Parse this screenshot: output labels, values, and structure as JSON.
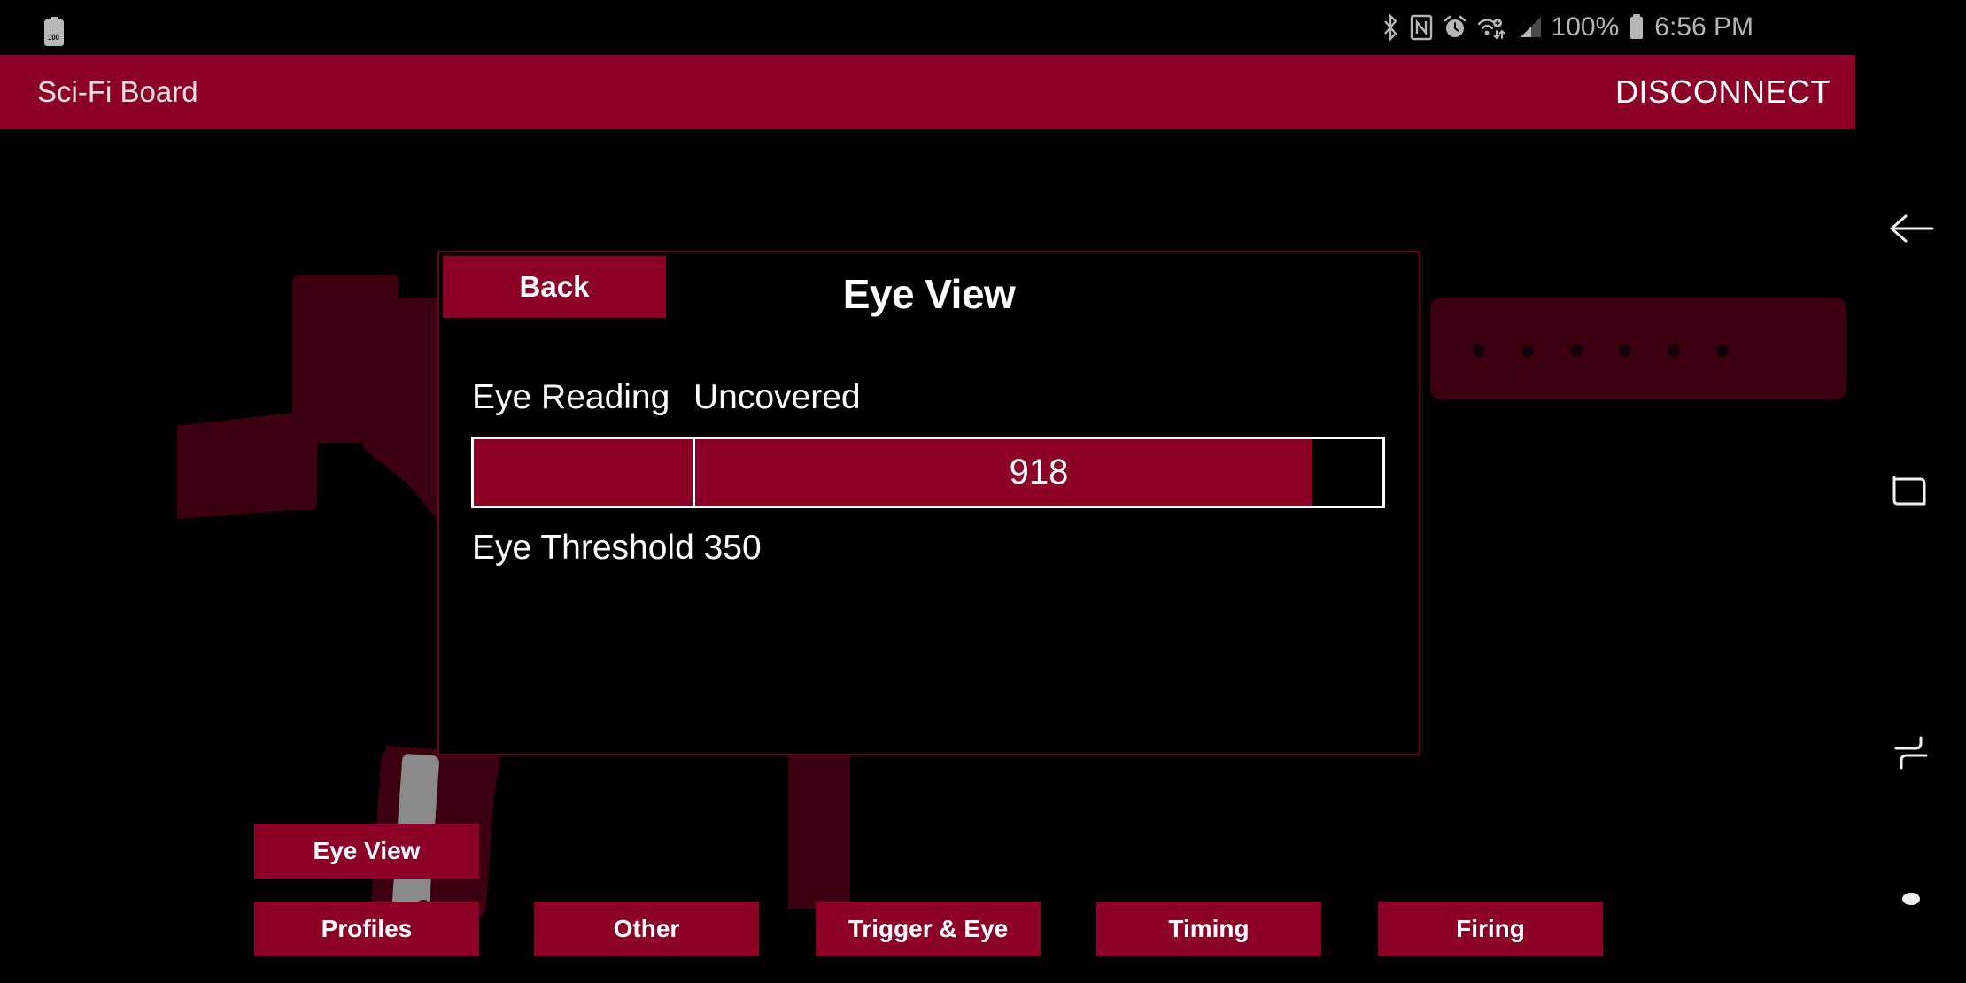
{
  "status_bar": {
    "battery_badge": "100",
    "icons": [
      "bluetooth-icon",
      "nfc-icon",
      "alarm-icon",
      "wifi-transfer-icon",
      "cellular-signal-icon"
    ],
    "battery_percent": "100%",
    "battery_icon": "battery-full-icon",
    "clock": "6:56 PM"
  },
  "app_bar": {
    "title": "Sci-Fi Board",
    "action_label": "DISCONNECT",
    "background_color": "#8c0028"
  },
  "dialog": {
    "back_label": "Back",
    "title": "Eye View",
    "reading_label": "Eye Reading",
    "reading_state": "Uncovered",
    "threshold_text": "Eye Threshold 350",
    "border_color": "#6e0020"
  },
  "gauge": {
    "value": "918",
    "value_number": 918,
    "max": 1023,
    "fill_percent": 89.8,
    "threshold": 350,
    "fill_color": "#8c0028",
    "border_color": "#ffffff",
    "track_color": "#000000"
  },
  "bottom_nav": {
    "buttons": [
      {
        "label": "Eye View",
        "name": "btn-eye-view"
      },
      {
        "label": "Profiles",
        "name": "btn-profiles"
      },
      {
        "label": "Other",
        "name": "btn-other"
      },
      {
        "label": "Trigger & Eye",
        "name": "btn-trigger"
      },
      {
        "label": "Timing",
        "name": "btn-timing"
      },
      {
        "label": "Firing",
        "name": "btn-firing"
      }
    ],
    "button_color": "#8c0028"
  },
  "nav_rail": {
    "items": [
      "back-arrow-icon",
      "recents-square-icon",
      "split-screen-icon",
      "home-dot-icon"
    ]
  },
  "background_art": {
    "subject": "sci-fi-blaster-silhouette",
    "color": "#3d0011",
    "accent_color": "#5c0019",
    "detail_color": "#8a8a8a"
  }
}
